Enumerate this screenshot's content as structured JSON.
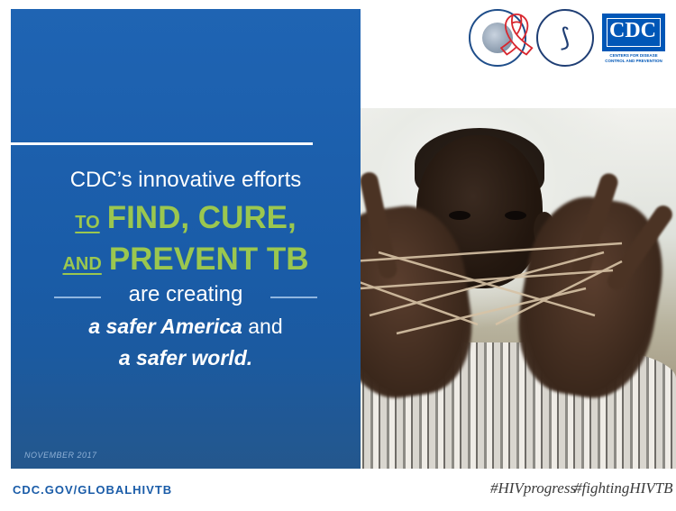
{
  "panel": {
    "line1": "CDC’s innovative efforts",
    "line2_prefix": "TO",
    "line2_main": "FIND, CURE,",
    "line3_prefix": "AND",
    "line3_main": "PREVENT TB",
    "line4": "are creating",
    "line5_bold": "a safer America",
    "line5_rest": " and",
    "line6": "a safer world.",
    "date": "NOVEMBER 2017"
  },
  "logos": {
    "cdc_text": "CDC",
    "cdc_tagline": "CENTERS FOR DISEASE CONTROL AND PREVENTION"
  },
  "footer": {
    "url": "CDC.GOV/GLOBALHIVTB",
    "hashtag1": "#HIVprogress",
    "hashtag2": "#fightingHIVTB"
  },
  "colors": {
    "panel_blue": "#1f64b3",
    "accent_green": "#9bc74f",
    "cdc_blue": "#0057b7"
  },
  "icons": [
    "state-department-seal-icon",
    "hhs-eagle-seal-icon",
    "cdc-logo-icon",
    "red-ribbon-icon"
  ]
}
